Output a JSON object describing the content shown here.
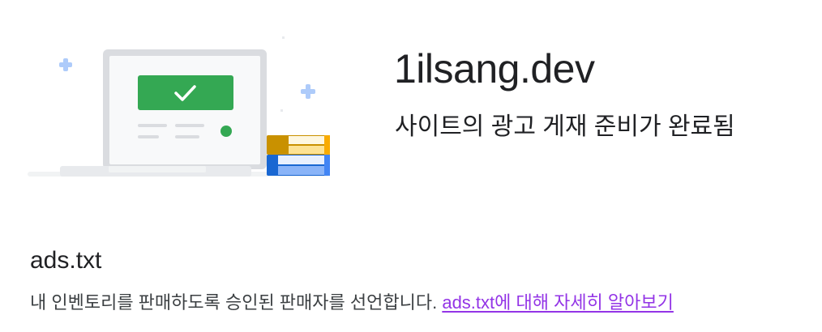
{
  "site": {
    "domain": "1ilsang.dev",
    "status": "사이트의 광고 게재 준비가 완료됨"
  },
  "illustration": {
    "check_icon": "check-icon",
    "colors": {
      "card_green": "#34a853",
      "dot_green": "#34a853",
      "book_yellow": "#f9ab00",
      "book_blue": "#4285f4",
      "sparkle_blue": "#aecbfa"
    }
  },
  "ads_txt": {
    "heading": "ads.txt",
    "description": "내 인벤토리를 판매하도록 승인된 판매자를 선언합니다.",
    "learn_more_link": "ads.txt에 대해 자세히 알아보기",
    "link_color": "#9334e6"
  }
}
